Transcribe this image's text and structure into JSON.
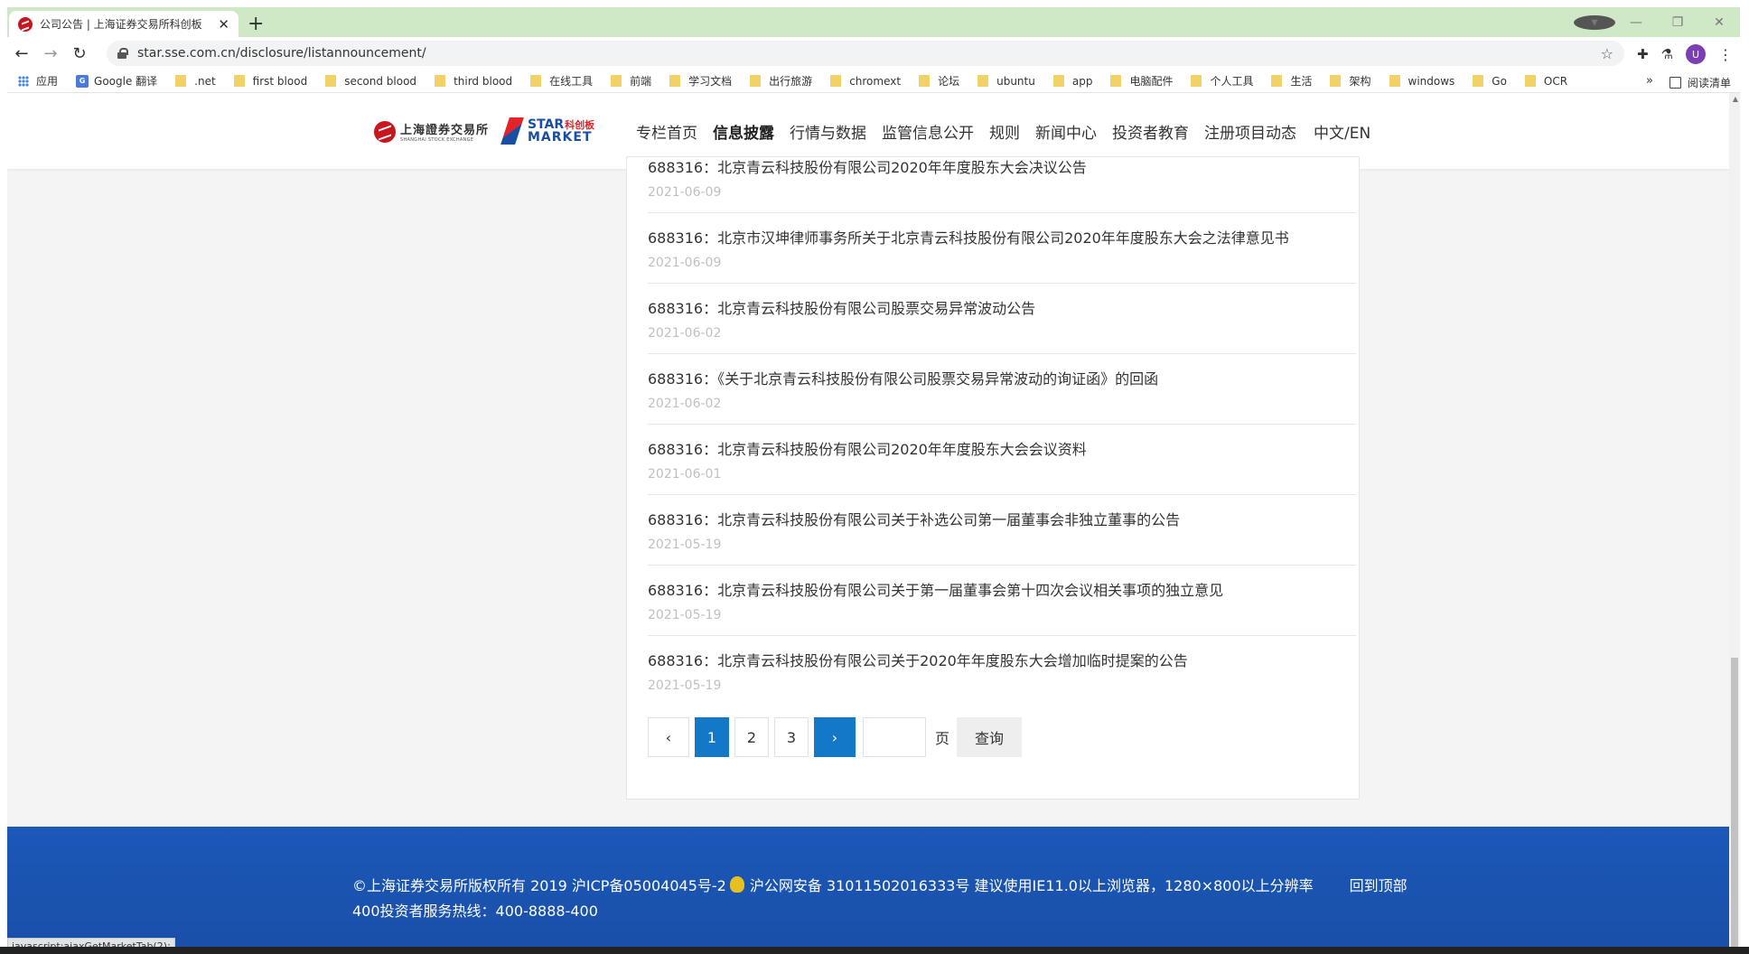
{
  "browser": {
    "tab_title": "公司公告 | 上海证券交易所科创板",
    "url": "star.sse.com.cn/disclosure/listannouncement/",
    "avatar_letter": "U",
    "bookmarks": [
      "应用",
      "Google 翻译",
      ".net",
      "first blood",
      "second blood",
      "third blood",
      "在线工具",
      "前端",
      "学习文档",
      "出行旅游",
      "chromext",
      "论坛",
      "ubuntu",
      "app",
      "电脑配件",
      "个人工具",
      "生活",
      "架构",
      "windows",
      "Go",
      "OCR"
    ],
    "bookmarks_more": "»",
    "reading_list": "阅读清单",
    "status_text": "javascript:ajaxGetMarketTab(2);"
  },
  "site": {
    "logo_sse_cn": "上海證券交易所",
    "logo_sse_en": "SHANGHAI STOCK EXCHANGE",
    "logo_star_top": "STAR",
    "logo_star_cn": "科创板",
    "logo_star_bottom": "MARKET",
    "nav": [
      "专栏首页",
      "信息披露",
      "行情与数据",
      "监管信息公开",
      "规则",
      "新闻中心",
      "投资者教育",
      "注册项目动态"
    ],
    "nav_active": "信息披露",
    "lang": "中文/EN",
    "accent_color": "#1478c8",
    "footer_color": "#1b58b8"
  },
  "announcements": [
    {
      "title": "688316：北京青云科技股份有限公司2020年年度股东大会决议公告",
      "date": "2021-06-09"
    },
    {
      "title": "688316：北京市汉坤律师事务所关于北京青云科技股份有限公司2020年年度股东大会之法律意见书",
      "date": "2021-06-09"
    },
    {
      "title": "688316：北京青云科技股份有限公司股票交易异常波动公告",
      "date": "2021-06-02"
    },
    {
      "title": "688316：《关于北京青云科技股份有限公司股票交易异常波动的询证函》的回函",
      "date": "2021-06-02"
    },
    {
      "title": "688316：北京青云科技股份有限公司2020年年度股东大会会议资料",
      "date": "2021-06-01"
    },
    {
      "title": "688316：北京青云科技股份有限公司关于补选公司第一届董事会非独立董事的公告",
      "date": "2021-05-19"
    },
    {
      "title": "688316：北京青云科技股份有限公司关于第一届董事会第十四次会议相关事项的独立意见",
      "date": "2021-05-19"
    },
    {
      "title": "688316：北京青云科技股份有限公司关于2020年年度股东大会增加临时提案的公告",
      "date": "2021-05-19"
    }
  ],
  "pagination": {
    "prev": "‹",
    "pages": [
      "1",
      "2",
      "3"
    ],
    "current": "1",
    "next": "›",
    "page_unit": "页",
    "query_label": "查询"
  },
  "footer": {
    "copyright": "©上海证券交易所版权所有 2019 沪ICP备05004045号-2",
    "police": "沪公网安备 31011502016333号 建议使用IE11.0以上浏览器，1280×800以上分辨率",
    "back_to_top": "回到顶部",
    "hotline": "400投资者服务热线：400-8888-400"
  }
}
